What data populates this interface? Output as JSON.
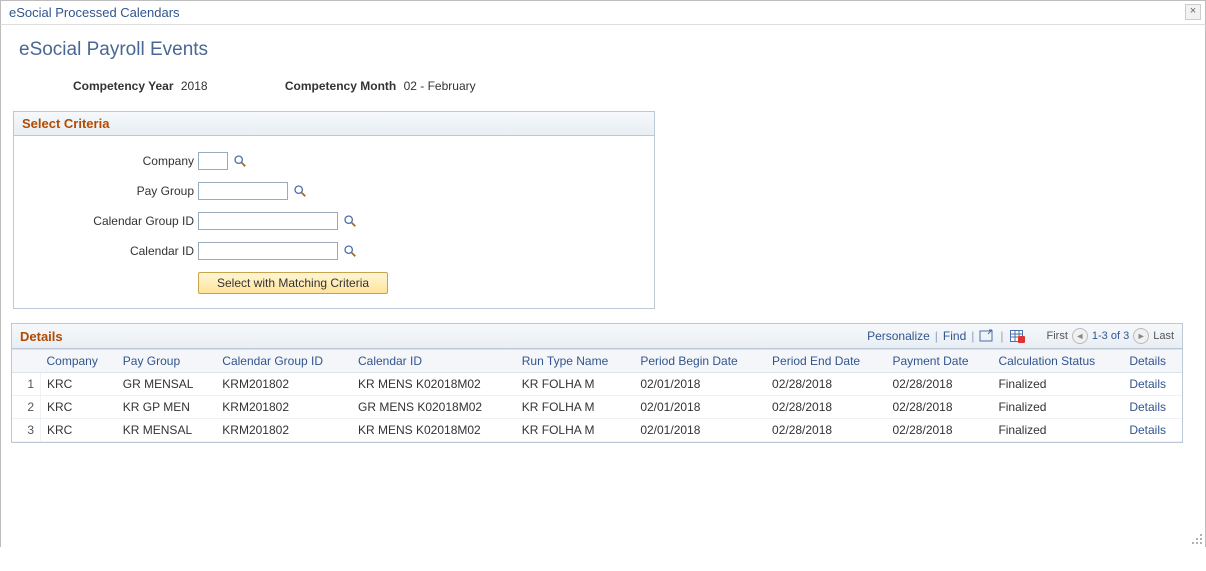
{
  "modal": {
    "title": "eSocial Processed Calendars"
  },
  "page": {
    "title": "eSocial Payroll Events",
    "competency_year_label": "Competency Year",
    "competency_year_value": "2018",
    "competency_month_label": "Competency Month",
    "competency_month_value": "02 - February"
  },
  "criteria": {
    "title": "Select Criteria",
    "company_label": "Company",
    "paygroup_label": "Pay Group",
    "cal_group_label": "Calendar Group ID",
    "cal_id_label": "Calendar ID",
    "company_value": "",
    "paygroup_value": "",
    "cal_group_value": "",
    "cal_id_value": "",
    "button_label": "Select with Matching Criteria"
  },
  "grid": {
    "title": "Details",
    "personalize": "Personalize",
    "find": "Find",
    "pager_first": "First",
    "pager_range": "1-3 of 3",
    "pager_last": "Last",
    "headers": {
      "company": "Company",
      "paygroup": "Pay Group",
      "cal_group": "Calendar Group ID",
      "cal_id": "Calendar ID",
      "runtype": "Run Type Name",
      "begin": "Period Begin Date",
      "end": "Period End Date",
      "payment": "Payment Date",
      "status": "Calculation Status",
      "details": "Details"
    },
    "rows": [
      {
        "n": "1",
        "company": "KRC",
        "paygroup": "GR MENSAL",
        "cal_group": "KRM201802",
        "cal_id": "KR MENS K02018M02",
        "runtype": "KR FOLHA M",
        "begin": "02/01/2018",
        "end": "02/28/2018",
        "payment": "02/28/2018",
        "status": "Finalized",
        "details": "Details"
      },
      {
        "n": "2",
        "company": "KRC",
        "paygroup": "KR GP MEN",
        "cal_group": "KRM201802",
        "cal_id": "GR MENS K02018M02",
        "runtype": "KR FOLHA M",
        "begin": "02/01/2018",
        "end": "02/28/2018",
        "payment": "02/28/2018",
        "status": "Finalized",
        "details": "Details"
      },
      {
        "n": "3",
        "company": "KRC",
        "paygroup": "KR MENSAL",
        "cal_group": "KRM201802",
        "cal_id": "KR MENS K02018M02",
        "runtype": "KR FOLHA M",
        "begin": "02/01/2018",
        "end": "02/28/2018",
        "payment": "02/28/2018",
        "status": "Finalized",
        "details": "Details"
      }
    ]
  }
}
